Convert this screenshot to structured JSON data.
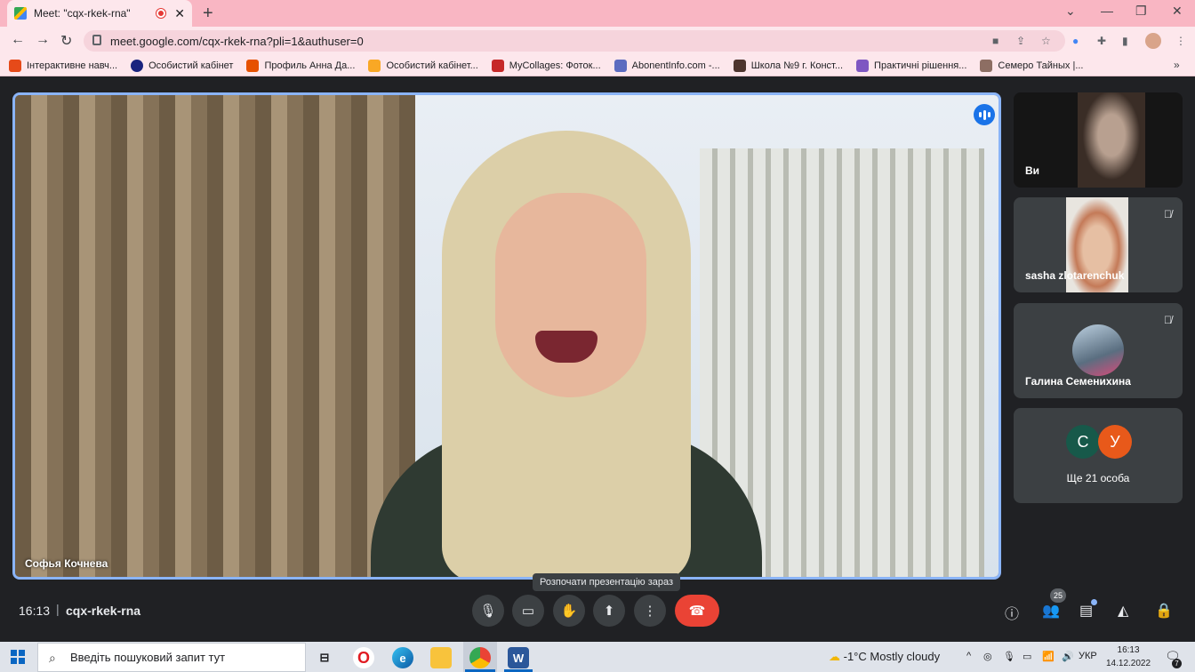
{
  "browser": {
    "tab_title": "Meet: \"cqx-rkek-rna\"",
    "new_tab": "+",
    "window_controls": [
      "⌄",
      "—",
      "❐",
      "✕"
    ],
    "url": "meet.google.com/cqx-rkek-rna?pli=1&authuser=0",
    "bookmarks": [
      {
        "label": "Інтерактивне навч...",
        "color": "#e64a19"
      },
      {
        "label": "Особистий кабінет",
        "color": "#1a237e"
      },
      {
        "label": "Профиль Анна Да...",
        "color": "#e65100"
      },
      {
        "label": "Особистий кабінет...",
        "color": "#f9a825"
      },
      {
        "label": "MyCollages: Фоток...",
        "color": "#c62828"
      },
      {
        "label": "AbonentInfo.com -...",
        "color": "#5c6bc0"
      },
      {
        "label": "Школа №9 г. Конст...",
        "color": "#4e342e"
      },
      {
        "label": "Практичні рішення...",
        "color": "#7e57c2"
      },
      {
        "label": "Семеро Тайных |...",
        "color": "#8d6e63"
      }
    ],
    "bookmarks_more": "»"
  },
  "meeting": {
    "main_speaker": "Софья Кочнева",
    "participants": [
      {
        "name": "Ви"
      },
      {
        "name": "sasha zlotarenchuk"
      },
      {
        "name": "Галина Семенихина"
      }
    ],
    "more_avatars": [
      {
        "letter": "С",
        "color": "#17594a"
      },
      {
        "letter": "У",
        "color": "#e8591a"
      }
    ],
    "more_label": "Ще 21 особа",
    "tooltip": "Розпочати презентацію зараз",
    "time": "16:13",
    "separator": "|",
    "code": "cqx-rkek-rna",
    "participant_count": "25",
    "colors": {
      "active_border": "#8ab4f8",
      "hangup": "#ea4335",
      "speaking": "#1a73e8"
    }
  },
  "taskbar": {
    "search_placeholder": "Введіть пошуковий запит тут",
    "weather": "-1°C  Mostly cloudy",
    "language": "УКР",
    "clock_time": "16:13",
    "clock_date": "14.12.2022",
    "notifications": "7"
  }
}
